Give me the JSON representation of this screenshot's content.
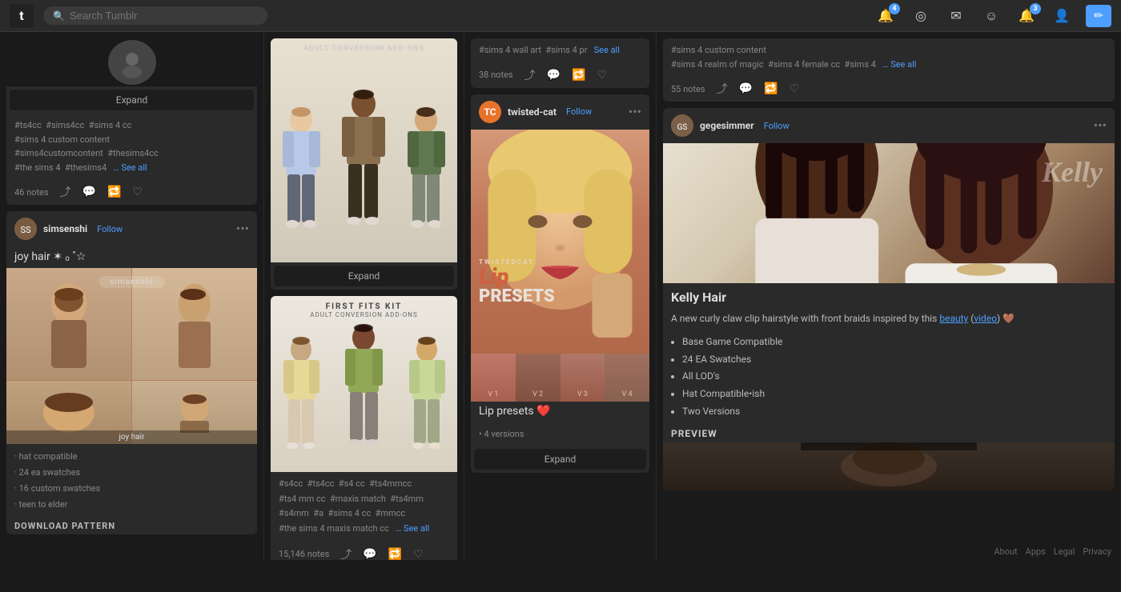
{
  "nav": {
    "logo": "t",
    "search_placeholder": "Search Tumblr",
    "icons": [
      {
        "name": "notifications-icon",
        "badge": "4",
        "symbol": "🔔"
      },
      {
        "name": "radar-icon",
        "badge": null,
        "symbol": "◎"
      },
      {
        "name": "messages-icon",
        "badge": null,
        "symbol": "✉"
      },
      {
        "name": "inbox-icon",
        "badge": null,
        "symbol": "☺"
      },
      {
        "name": "activity-icon",
        "badge": "3",
        "symbol": "🔔"
      },
      {
        "name": "account-icon",
        "badge": null,
        "symbol": "👤"
      }
    ],
    "compose_icon": "✏"
  },
  "col1": {
    "card1": {
      "expand_label": "Expand",
      "tags": "#ts4cc  #sims4cc  #sims 4 cc  #sims 4 custom content  #sims4customcontent  #thesims4cc  #the sims 4  #thesims4",
      "see_all": "… See all",
      "notes": "46 notes"
    },
    "card2": {
      "username": "simsenshi",
      "follow": "Follow",
      "title": "joy hair ✶ ₒ ˚☆",
      "features": [
        "· hat compatible",
        "· 24 ea swatches",
        "· 16 custom swatches",
        "· teen to elder"
      ],
      "download_label": "DOWNLOAD PATTERN"
    }
  },
  "col2": {
    "card1": {
      "image_label": "ADULT CONVERSION ADD-ONS",
      "expand_label": "Expand"
    },
    "card2": {
      "image_label": "FIRST FITS KIT",
      "image_sublabel": "ADULT CONVERSION ADD-ONS",
      "tags": "#s4cc  #ts4cc  #s4 cc  #ts4mmcc  #ts4 mm cc  #maxis match  #ts4mm  #s4mm  #a  #sims 4 cc  #mmcc  #the sims 4 maxis match cc",
      "see_all": "… See all",
      "notes": "15,146 notes"
    }
  },
  "col3": {
    "card1": {
      "username": "twisted-cat",
      "follow": "Follow",
      "title": "Lip presets ❤️",
      "versions": "4 versions",
      "expand_label": "Expand",
      "image_main_text": "TWISTEDCAT\nLip\nPRESETS",
      "version_labels": [
        "V 1",
        "V 2",
        "V 3",
        "V 4"
      ],
      "notes_above": ""
    },
    "card_top_tags": {
      "tags": "#sims 4 wall art  #sims 4 pr",
      "see_all": "See all",
      "notes": "38 notes"
    }
  },
  "col4": {
    "card_top": {
      "tags": "#sims 4 custom content  #sims 4 realm of magic  #sims 4 female cc  #sims 4",
      "see_all": "… See all",
      "notes": "55 notes"
    },
    "kelly_card": {
      "username": "gegesimmer",
      "follow": "Follow",
      "title": "Kelly Hair",
      "description": "A new curly claw clip hairstyle with front braids inspired by this",
      "link1": "beauty",
      "link2": "video",
      "emoji": "🤎",
      "features": [
        "Base Game Compatible",
        "24 EA Swatches",
        "All LOD's",
        "Hat Compatible•ish",
        "Two Versions"
      ],
      "preview_label": "PREVIEW"
    }
  },
  "footer": {
    "links": [
      "About",
      "Apps",
      "Legal",
      "Privacy"
    ]
  }
}
